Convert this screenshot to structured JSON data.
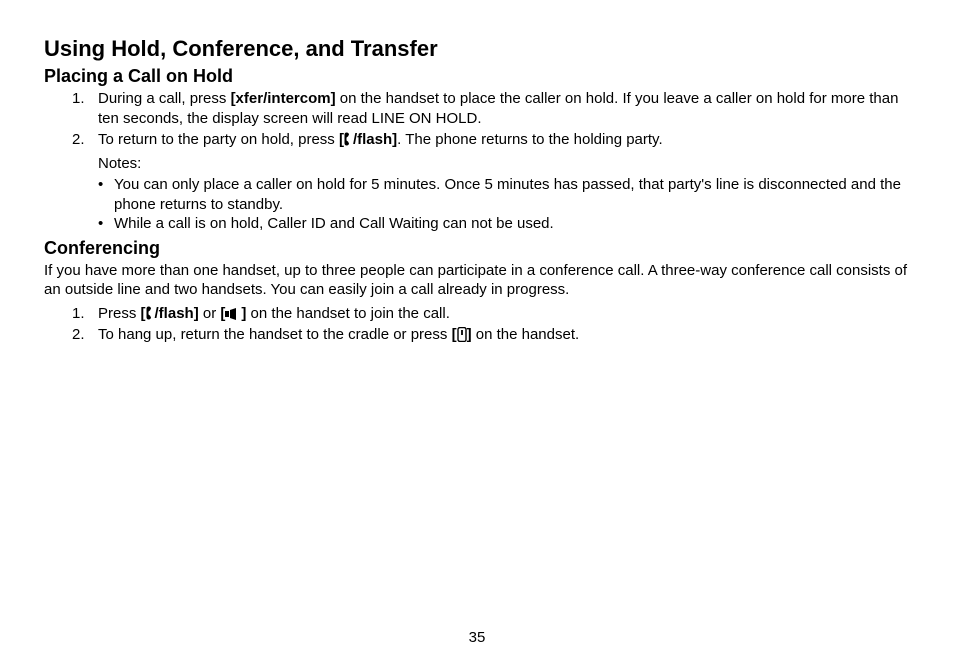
{
  "title": "Using Hold, Conference, and Transfer",
  "section1": {
    "heading": "Placing a Call on Hold",
    "step1_num": "1.",
    "step1_a": "During a call, press ",
    "step1_b": "[xfer/intercom]",
    "step1_c": " on the handset to place the caller on hold. If you leave a caller on hold for more than ten seconds, the display screen will read LINE ON HOLD.",
    "step2_num": "2.",
    "step2_a": "To return to the party on hold, press ",
    "step2_b1": "[",
    "step2_b2": "/flash]",
    "step2_c": ". The phone returns to the holding party.",
    "notes_label": "Notes:",
    "note1_a": "You can only place a caller on hold for 5 minutes. Once 5 minutes has passed, that party's line is disconnect",
    "note1_b": "ed and the phone returns to standby.",
    "note2": "While a call is on hold, Caller ID and Call Waiting can not be used."
  },
  "section2": {
    "heading": "Conferencing",
    "intro": "If you have more than one handset, up to three people can participate in a conference call. A three-way conference call consists of an outside line and two handsets. You can easily join a call already in progress.",
    "step1_num": "1.",
    "step1_a": "Press ",
    "step1_b1": "[",
    "step1_b2": "/flash]",
    "step1_c": " or ",
    "step1_d1": "[",
    "step1_d2": "]",
    "step1_e": " on the handset to join the call.",
    "step2_num": "2.",
    "step2_a": "To hang up, return the handset to the cradle or press ",
    "step2_b1": "[",
    "step2_b2": "]",
    "step2_c": " on the handset."
  },
  "page_number": "35"
}
